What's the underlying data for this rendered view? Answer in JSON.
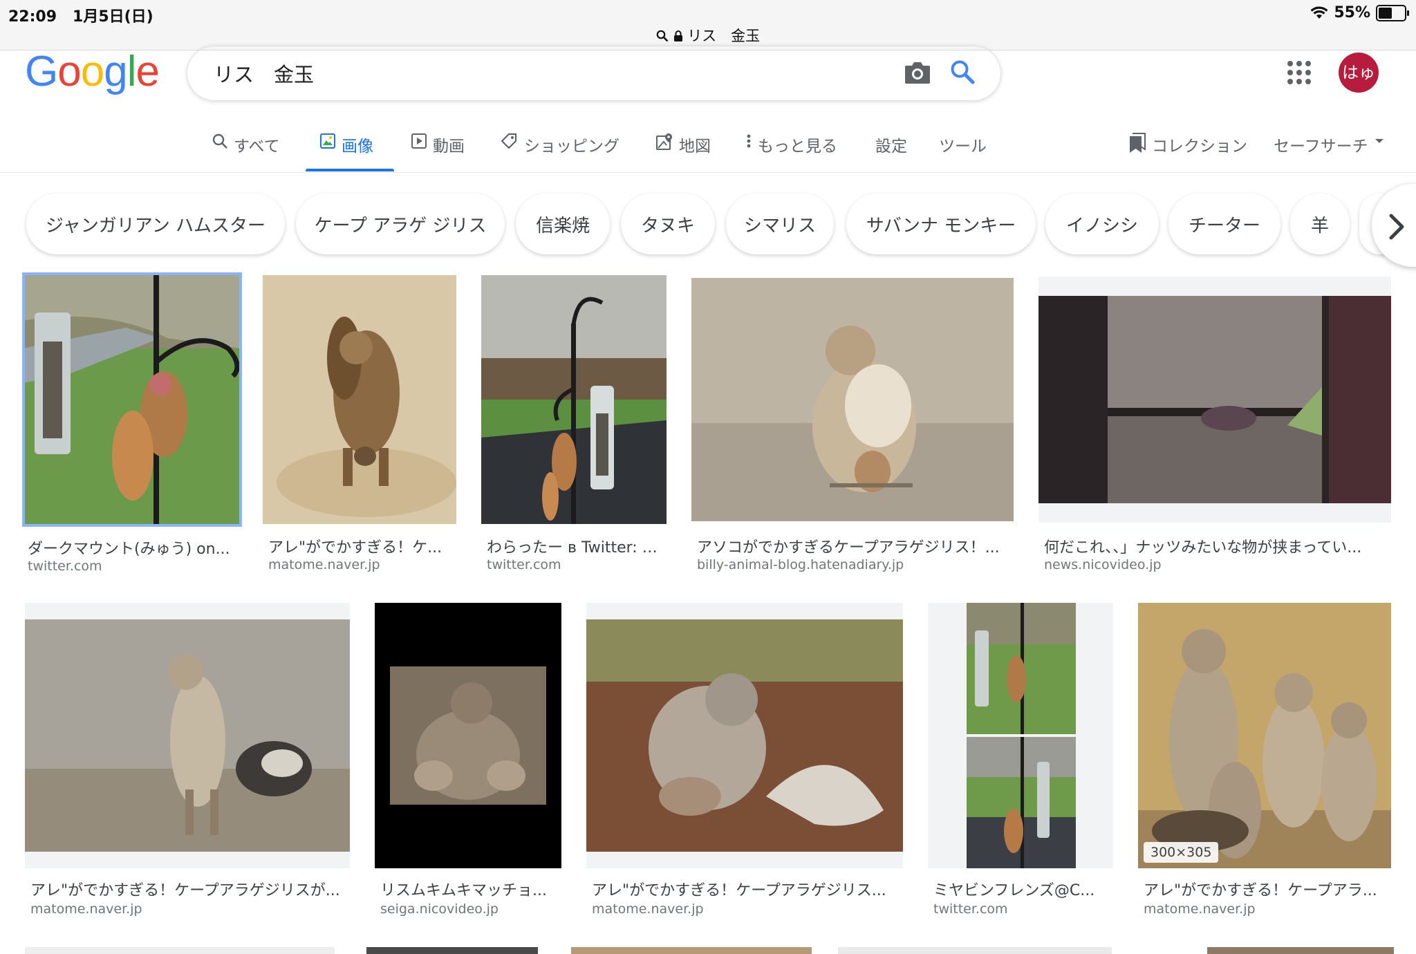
{
  "status": {
    "time": "22:09",
    "date": "1月5日(日)",
    "battery": "55%",
    "battery_level": 0.55
  },
  "browser": {
    "url_text": "リス　金玉"
  },
  "google": {
    "logo": "Google",
    "query": "リス　金玉",
    "avatar_text": "はゅ"
  },
  "tabs": [
    {
      "label": "すべて",
      "icon": "search-icon"
    },
    {
      "label": "画像",
      "icon": "image-icon",
      "active": true
    },
    {
      "label": "動画",
      "icon": "video-icon"
    },
    {
      "label": "ショッピング",
      "icon": "tag-icon"
    },
    {
      "label": "地図",
      "icon": "map-icon"
    },
    {
      "label": "もっと見る",
      "icon": "more-vert-icon"
    },
    {
      "label": "設定"
    },
    {
      "label": "ツール"
    }
  ],
  "right_tabs": {
    "collection": "コレクション",
    "safesearch": "セーフサーチ"
  },
  "chips": [
    "ジャンガリアン ハムスター",
    "ケープ アラゲ ジリス",
    "信楽焼",
    "タヌキ",
    "シマリス",
    "サバンナ モンキー",
    "イノシシ",
    "チーター",
    "羊"
  ],
  "results_row1": [
    {
      "title": "ダークマウント(みゅう) on...",
      "site": "twitter.com"
    },
    {
      "title": "アレ\"がでかすぎる！ケ...",
      "site": "matome.naver.jp"
    },
    {
      "title": "わらったー в Twitter: \"...",
      "site": "twitter.com"
    },
    {
      "title": "アソコがでかすぎるケープアラゲジリス！...",
      "site": "billy-animal-blog.hatenadiary.jp"
    },
    {
      "title": "何だこれ、、」ナッツみたいな物が挟まってい...",
      "site": "news.nicovideo.jp"
    }
  ],
  "results_row2": [
    {
      "title": "アレ\"がでかすぎる！ケープアラゲジリスが...",
      "site": "matome.naver.jp"
    },
    {
      "title": "リスムキムキマッチョ...",
      "site": "seiga.nicovideo.jp"
    },
    {
      "title": "アレ\"がでかすぎる！ケープアラゲジリス...",
      "site": "matome.naver.jp"
    },
    {
      "title": "ミヤビンフレンズ@C...",
      "site": "twitter.com"
    },
    {
      "title": "アレ\"がでかすぎる！ケープアラ...",
      "site": "matome.naver.jp",
      "dims": "300×305"
    }
  ],
  "colors": {
    "accent": "#1a73e8",
    "avatar": "#b71c3c"
  }
}
